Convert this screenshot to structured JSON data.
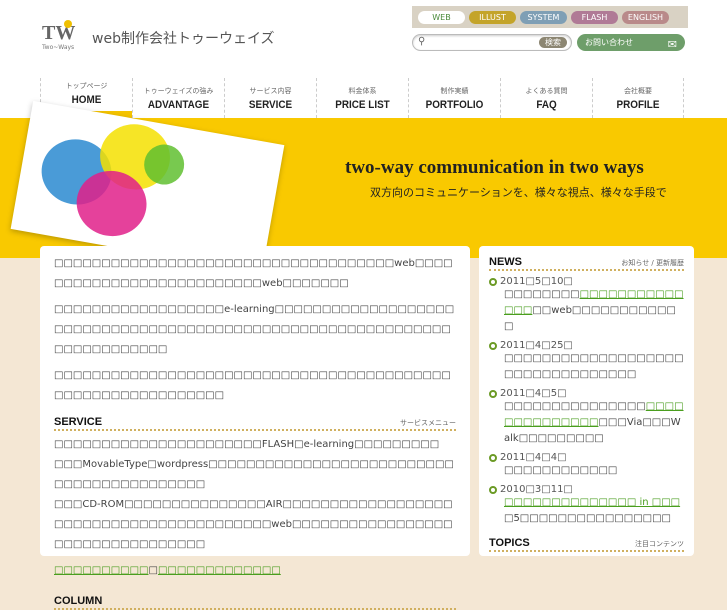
{
  "header": {
    "logo_text": "TW",
    "logo_sub": "Two~Ways",
    "site_name": "web制作会社トゥーウェイズ",
    "categories": [
      {
        "label": "WEB",
        "color": "#ffffff",
        "text": "#4a8a3a"
      },
      {
        "label": "ILLUST",
        "color": "#c4a42a",
        "text": "#ffffff"
      },
      {
        "label": "SYSTEM",
        "color": "#7f9fb5",
        "text": "#ffffff"
      },
      {
        "label": "FLASH",
        "color": "#b07a96",
        "text": "#ffffff"
      },
      {
        "label": "ENGLISH",
        "color": "#b98a8a",
        "text": "#ffffff"
      }
    ],
    "search_placeholder": "",
    "search_button": "検索",
    "contact": "お問い合わせ"
  },
  "nav": [
    {
      "jp": "トップページ",
      "en": "HOME"
    },
    {
      "jp": "トゥーウェイズの強み",
      "en": "ADVANTAGE"
    },
    {
      "jp": "サービス内容",
      "en": "SERVICE"
    },
    {
      "jp": "料金体系",
      "en": "PRICE LIST"
    },
    {
      "jp": "制作実績",
      "en": "PORTFOLIO"
    },
    {
      "jp": "よくある質問",
      "en": "FAQ"
    },
    {
      "jp": "会社概要",
      "en": "PROFILE"
    }
  ],
  "banner": {
    "tagline": "two-way communication in two ways",
    "tagline_jp": "双方向のコミュニケーションを、様々な視点、様々な手段で"
  },
  "main": {
    "paragraphs": [
      "□□□□□□□□□□□□□□□□□□□□□□□□□□□□□□□□□□□□web□□□□□□□□□□□□□□□□□□□□□□□□□□web□□□□□□□",
      "□□□□□□□□□□□□□□□□□□e-learning□□□□□□□□□□□□□□□□□□□□□□□□□□□□□□□□□□□□□□□□□□□□□□□□□□□□□□□□□□□□□□□□□□□□□□□□□",
      "□□□□□□□□□□□□□□□□□□□□□□□□□□□□□□□□□□□□□□□□□□□□□□□□□□□□□□□□□□□□"
    ],
    "service": {
      "title": "SERVICE",
      "subtitle": "サービスメニュー",
      "lines": [
        "□□□□□□□□□□□□□□□□□□□□□□FLASH□e-learning□□□□□□□□□",
        "□□□MovableType□wordpress□□□□□□□□□□□□□□□□□□□□□□□□□□□□□□□□□□□□□□□□□□",
        "□□□CD-ROM□□□□□□□□□□□□□□□AIR□□□□□□□□□□□□□□□□□□□□□□□□□□□□□□□□□□□□□□□□□web□□□□□□□□□□□□□□□□□□□□□□□□□□□□□□□□□"
      ],
      "link1": "□□□□□□□□□□",
      "link_sep": "□",
      "link2": "□□□□□□□□□□□□□"
    },
    "column_title": "COLUMN"
  },
  "news": {
    "title": "NEWS",
    "subtitle": "お知らせ / 更新履歴",
    "items": [
      {
        "date": "2011□5□10□",
        "pre": "□□□□□□□□",
        "link": "□□□□□□□□□□□□□□",
        "post": "□□web□□□□□□□□□□□□"
      },
      {
        "date": "2011□4□25□",
        "pre": "□□□□□□□□□□□□□□□□□□□□□□□□□□□□□□□□□",
        "link": "",
        "post": ""
      },
      {
        "date": "2011□4□5□",
        "pre": "□□□□□□□□□□□□□□□",
        "link": "□□□□□□□□□□□□□□",
        "post": "□□□Via□□□Walk□□□□□□□□□"
      },
      {
        "date": "2011□4□4□",
        "pre": "□□□□□□□□□□□□",
        "link": "",
        "post": ""
      },
      {
        "date": "2010□3□11□",
        "pre": "",
        "link": "□□□□□□□□□□□□□□ in □□□",
        "post": "□5□□□□□□□□□□□□□□□□"
      }
    ]
  },
  "topics": {
    "title": "TOPICS",
    "subtitle": "注目コンテンツ"
  }
}
